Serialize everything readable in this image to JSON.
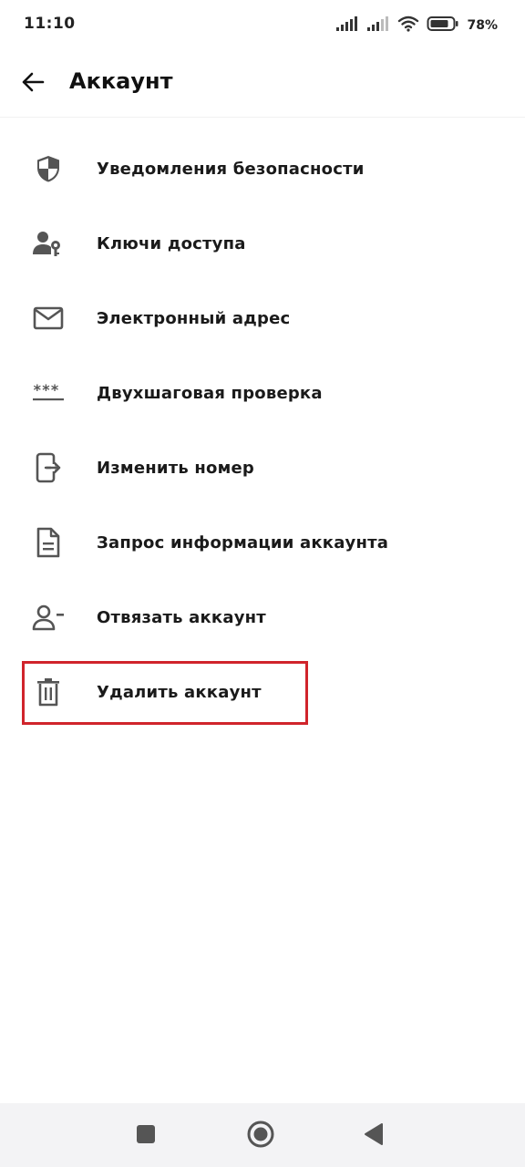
{
  "status_bar": {
    "time": "11:10",
    "battery_percent": "78%",
    "icons": [
      "signal-icon",
      "signal-icon",
      "wifi-icon",
      "battery-icon"
    ]
  },
  "app_bar": {
    "title": "Аккаунт",
    "back_icon": "arrow-left-icon"
  },
  "menu": {
    "items": [
      {
        "label": "Уведомления безопасности",
        "icon": "shield-icon"
      },
      {
        "label": "Ключи доступа",
        "icon": "person-key-icon"
      },
      {
        "label": "Электронный адрес",
        "icon": "mail-icon"
      },
      {
        "label": "Двухшаговая проверка",
        "icon": "password-dots-icon"
      },
      {
        "label": "Изменить номер",
        "icon": "phone-transfer-icon"
      },
      {
        "label": "Запрос информации аккаунта",
        "icon": "document-icon"
      },
      {
        "label": "Отвязать аккаунт",
        "icon": "person-remove-icon"
      },
      {
        "label": "Удалить аккаунт",
        "icon": "trash-icon"
      }
    ]
  },
  "nav_bar": {
    "buttons": [
      "recents-square-icon",
      "home-circle-icon",
      "back-triangle-icon"
    ]
  },
  "colors": {
    "highlight": "#d0242b",
    "icon": "#555555",
    "nav_background": "#f3f3f5"
  }
}
